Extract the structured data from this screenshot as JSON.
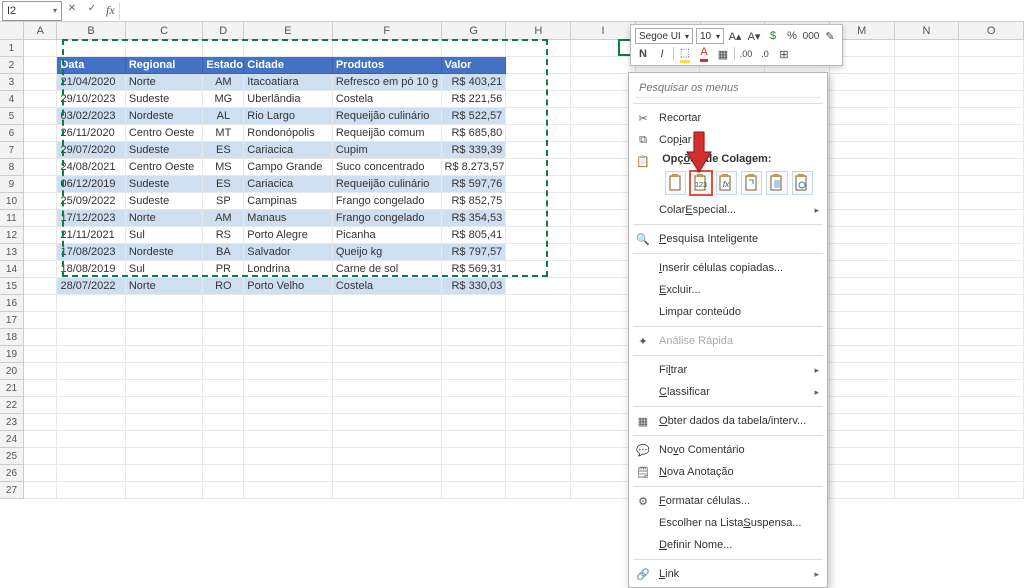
{
  "name_box": {
    "value": "I2"
  },
  "formula_bar": {
    "value": ""
  },
  "columns": [
    "A",
    "B",
    "C",
    "D",
    "E",
    "F",
    "G",
    "H",
    "I",
    "J",
    "K",
    "L",
    "M",
    "N",
    "O"
  ],
  "row_count": 27,
  "chart_data": {
    "type": "table",
    "headers": [
      "Data",
      "Regional",
      "Estado",
      "Cidade",
      "Produtos",
      "Valor"
    ],
    "rows": [
      [
        "21/04/2020",
        "Norte",
        "AM",
        "Itacoatiara",
        "Refresco em pó 10 g",
        "R$ 403,21"
      ],
      [
        "29/10/2023",
        "Sudeste",
        "MG",
        "Uberlândia",
        "Costela",
        "R$ 221,56"
      ],
      [
        "03/02/2023",
        "Nordeste",
        "AL",
        "Rio Largo",
        "Requeijão culinário",
        "R$ 522,57"
      ],
      [
        "26/11/2020",
        "Centro Oeste",
        "MT",
        "Rondonópolis",
        "Requeijão comum",
        "R$ 685,80"
      ],
      [
        "29/07/2020",
        "Sudeste",
        "ES",
        "Cariacica",
        "Cupim",
        "R$ 339,39"
      ],
      [
        "24/08/2021",
        "Centro Oeste",
        "MS",
        "Campo Grande",
        "Suco concentrado",
        "R$ 8.273,57"
      ],
      [
        "06/12/2019",
        "Sudeste",
        "ES",
        "Cariacica",
        "Requeijão culinário",
        "R$ 597,76"
      ],
      [
        "25/09/2022",
        "Sudeste",
        "SP",
        "Campinas",
        "Frango congelado",
        "R$ 852,75"
      ],
      [
        "17/12/2023",
        "Norte",
        "AM",
        "Manaus",
        "Frango congelado",
        "R$ 354,53"
      ],
      [
        "21/11/2021",
        "Sul",
        "RS",
        "Porto Alegre",
        "Picanha",
        "R$ 805,41"
      ],
      [
        "17/08/2023",
        "Nordeste",
        "BA",
        "Salvador",
        "Queijo kg",
        "R$ 797,57"
      ],
      [
        "18/08/2019",
        "Sul",
        "PR",
        "Londrina",
        "Carne de sol",
        "R$ 569,31"
      ],
      [
        "28/07/2022",
        "Norte",
        "RO",
        "Porto Velho",
        "Costela",
        "R$ 330,03"
      ]
    ]
  },
  "mini_toolbar": {
    "font_name": "Segoe UI",
    "font_size": "10",
    "bold": "N",
    "italic": "I"
  },
  "context_menu": {
    "search_placeholder": "Pesquisar os menus",
    "cut": "Recortar",
    "copy": "Copiar",
    "paste_options_heading": "Opções de Colagem:",
    "paste_special": "Colar Especial...",
    "smart_lookup": "Pesquisa Inteligente",
    "insert_copied": "Inserir células copiadas...",
    "delete": "Excluir...",
    "clear": "Limpar conteúdo",
    "quick_analysis": "Análise Rápida",
    "filter": "Filtrar",
    "sort": "Classificar",
    "table_data": "Obter dados da tabela/interv...",
    "new_comment": "Novo Comentário",
    "new_note": "Nova Anotação",
    "format_cells": "Formatar células...",
    "dropdown_list": "Escolher na Lista Suspensa...",
    "define_name": "Definir Nome...",
    "link": "Link"
  }
}
